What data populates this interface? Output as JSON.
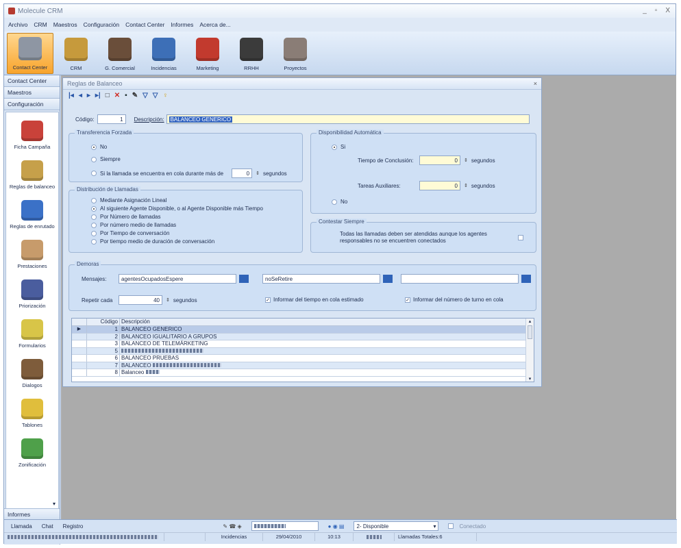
{
  "window": {
    "title": "Molecule CRM",
    "controls": [
      "_",
      "▫",
      "X"
    ]
  },
  "menu": [
    "Archivo",
    "CRM",
    "Maestros",
    "Configuración",
    "Contact Center",
    "Informes",
    "Acerca de..."
  ],
  "ribbon": [
    {
      "label": "Contact Center",
      "color": "#8e96a3",
      "active": true
    },
    {
      "label": "CRM",
      "color": "#c69a3c"
    },
    {
      "label": "G. Comercial",
      "color": "#6a4e3a"
    },
    {
      "label": "Incidencias",
      "color": "#3d6fb7"
    },
    {
      "label": "Marketing",
      "color": "#c23a2e"
    },
    {
      "label": "RRHH",
      "color": "#3b3b3b"
    },
    {
      "label": "Proyectos",
      "color": "#8a7d76"
    }
  ],
  "sidebar": {
    "headers": [
      "Contact Center",
      "Maestros",
      "Configuración"
    ],
    "items": [
      {
        "label": "Ficha Campaña",
        "color": "#c9423a"
      },
      {
        "label": "Reglas de balanceo",
        "color": "#c6a04a"
      },
      {
        "label": "Reglas de enrutado",
        "color": "#3b71c7"
      },
      {
        "label": "Prestaciones",
        "color": "#c79b6b"
      },
      {
        "label": "Priorización",
        "color": "#4a5d9e"
      },
      {
        "label": "Formularios",
        "color": "#d8c548"
      },
      {
        "label": "Dialogos",
        "color": "#7e5c3b"
      },
      {
        "label": "Tablones",
        "color": "#e0be3c"
      },
      {
        "label": "Zonificación",
        "color": "#4fa04a"
      }
    ],
    "footer": "Informes"
  },
  "form": {
    "title": "Reglas de Balanceo",
    "codigo_label": "Código:",
    "codigo_value": "1",
    "descripcion_label": "Descripción:",
    "descripcion_value": "BALANCEO GENERICO",
    "transferencia": {
      "title": "Transferencia Forzada",
      "opt_no": "No",
      "opt_siempre": "Siempre",
      "opt_si": "Si la llamada se encuentra en cola durante más de",
      "si_value": "0",
      "si_unit": "segundos"
    },
    "disponibilidad": {
      "title": "Disponibilidad Automática",
      "opt_si": "Si",
      "tiempo_label": "Tiempo de Conclusión:",
      "tiempo_value": "0",
      "tiempo_unit": "segundos",
      "tareas_label": "Tareas Auxiliares:",
      "tareas_value": "0",
      "tareas_unit": "segundos",
      "opt_no": "No"
    },
    "distribucion": {
      "title": "Distribución de Llamadas",
      "options": [
        "Mediante Asignación Lineal",
        "Al siguiente Agente Disponible, o al Agente Disponible más Tiempo",
        "Por Número de llamadas",
        "Por número medio de llamadas",
        "Por Tiempo de conversación",
        "Por tiempo medio de duración de conversación"
      ],
      "selected_index": 1
    },
    "contestar": {
      "title": "Contestar Siempre",
      "text": "Todas las llamadas deben ser atendidas aunque los agentes responsables no se encuentren conectados"
    },
    "demoras": {
      "title": "Demoras",
      "mensajes_label": "Mensajes:",
      "msg1": "agentesOcupadosEspere",
      "msg2": "noSeRetire",
      "msg3": "",
      "repetir_label": "Repetir cada",
      "repetir_value": "40",
      "repetir_unit": "segundos",
      "check1": "Informar del tiempo en cola estimado",
      "check2": "Informar del número de turno en cola"
    },
    "grid": {
      "headers": [
        "Código",
        "Descripción"
      ],
      "rows": [
        {
          "code": "1",
          "desc": "BALANCEO GENERICO"
        },
        {
          "code": "2",
          "desc": "BALANCEO IGUALITARIO A GRUPOS"
        },
        {
          "code": "3",
          "desc": "BALANCEO DE TELEMÁRKETING"
        },
        {
          "code": "5",
          "desc": ""
        },
        {
          "code": "6",
          "desc": "BALANCEO PRUEBAS"
        },
        {
          "code": "7",
          "desc": "BALANCEO"
        },
        {
          "code": "8",
          "desc": "Balanceo"
        }
      ]
    }
  },
  "status": {
    "tabs": [
      "Llamada",
      "Chat",
      "Registro"
    ],
    "estado": "2- Disponible",
    "conectado": "Conectado",
    "section": "Incidencias",
    "date": "29/04/2010",
    "time": "10:13",
    "llamadas": "Llamadas Totales:6"
  }
}
